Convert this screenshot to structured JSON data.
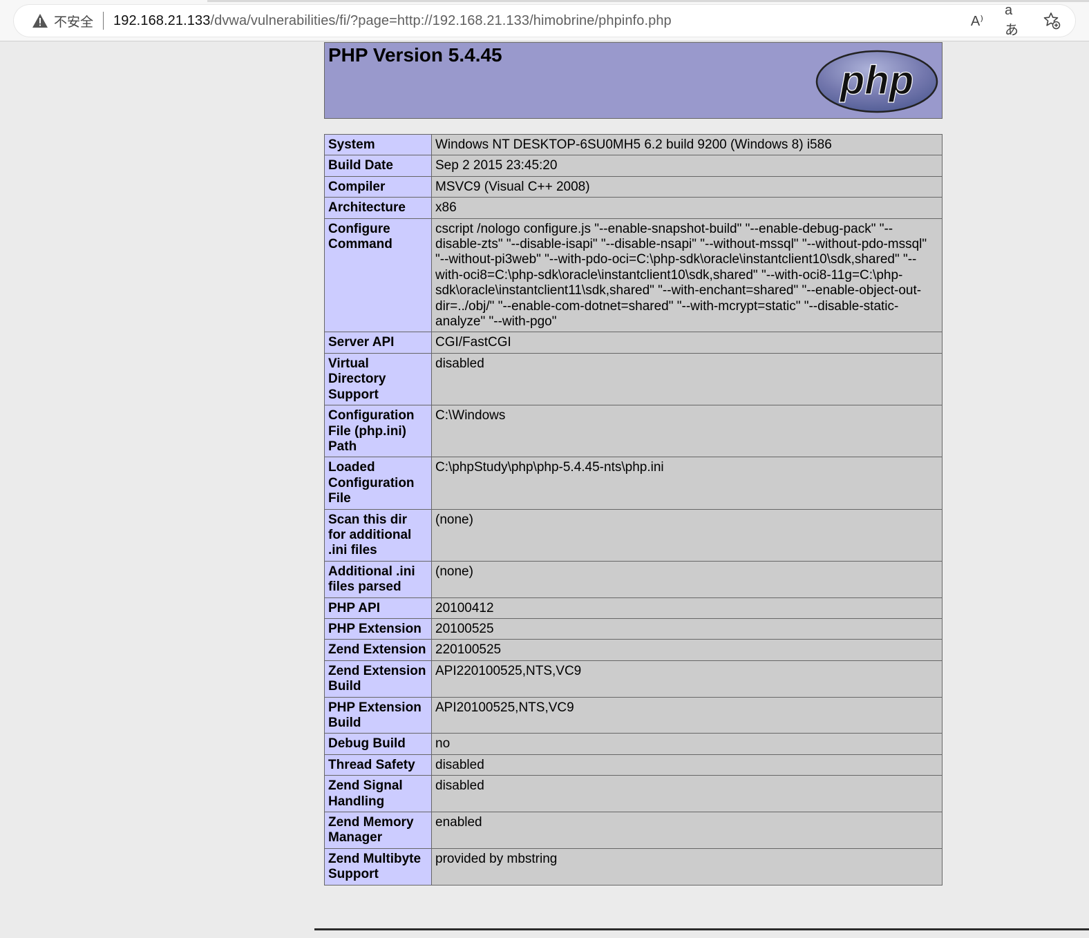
{
  "browser": {
    "insecure_label": "不安全",
    "url_host": "192.168.21.133",
    "url_path": "/dvwa/vulnerabilities/fi/?page=http://192.168.21.133/himobrine/phpinfo.php",
    "read_aloud_glyph": "A⁾",
    "translate_glyph": "aあ"
  },
  "header": {
    "title": "PHP Version 5.4.45",
    "logo_text": "php"
  },
  "rows": [
    {
      "label": "System",
      "value": "Windows NT DESKTOP-6SU0MH5 6.2 build 9200 (Windows 8) i586"
    },
    {
      "label": "Build Date",
      "value": "Sep 2 2015 23:45:20"
    },
    {
      "label": "Compiler",
      "value": "MSVC9 (Visual C++ 2008)"
    },
    {
      "label": "Architecture",
      "value": "x86"
    },
    {
      "label": "Configure Command",
      "value": "cscript /nologo configure.js \"--enable-snapshot-build\" \"--enable-debug-pack\" \"--disable-zts\" \"--disable-isapi\" \"--disable-nsapi\" \"--without-mssql\" \"--without-pdo-mssql\" \"--without-pi3web\" \"--with-pdo-oci=C:\\php-sdk\\oracle\\instantclient10\\sdk,shared\" \"--with-oci8=C:\\php-sdk\\oracle\\instantclient10\\sdk,shared\" \"--with-oci8-11g=C:\\php-sdk\\oracle\\instantclient11\\sdk,shared\" \"--with-enchant=shared\" \"--enable-object-out-dir=../obj/\" \"--enable-com-dotnet=shared\" \"--with-mcrypt=static\" \"--disable-static-analyze\" \"--with-pgo\""
    },
    {
      "label": "Server API",
      "value": "CGI/FastCGI"
    },
    {
      "label": "Virtual Directory Support",
      "value": "disabled"
    },
    {
      "label": "Configuration File (php.ini) Path",
      "value": "C:\\Windows"
    },
    {
      "label": "Loaded Configuration File",
      "value": "C:\\phpStudy\\php\\php-5.4.45-nts\\php.ini"
    },
    {
      "label": "Scan this dir for additional .ini files",
      "value": "(none)"
    },
    {
      "label": "Additional .ini files parsed",
      "value": "(none)"
    },
    {
      "label": "PHP API",
      "value": "20100412"
    },
    {
      "label": "PHP Extension",
      "value": "20100525"
    },
    {
      "label": "Zend Extension",
      "value": "220100525"
    },
    {
      "label": "Zend Extension Build",
      "value": "API220100525,NTS,VC9"
    },
    {
      "label": "PHP Extension Build",
      "value": "API20100525,NTS,VC9"
    },
    {
      "label": "Debug Build",
      "value": "no"
    },
    {
      "label": "Thread Safety",
      "value": "disabled"
    },
    {
      "label": "Zend Signal Handling",
      "value": "disabled"
    },
    {
      "label": "Zend Memory Manager",
      "value": "enabled"
    },
    {
      "label": "Zend Multibyte Support",
      "value": "provided by mbstring"
    }
  ],
  "colors": {
    "header_bg": "#9999cc",
    "label_bg": "#ccccff",
    "value_bg": "#cccccc"
  }
}
